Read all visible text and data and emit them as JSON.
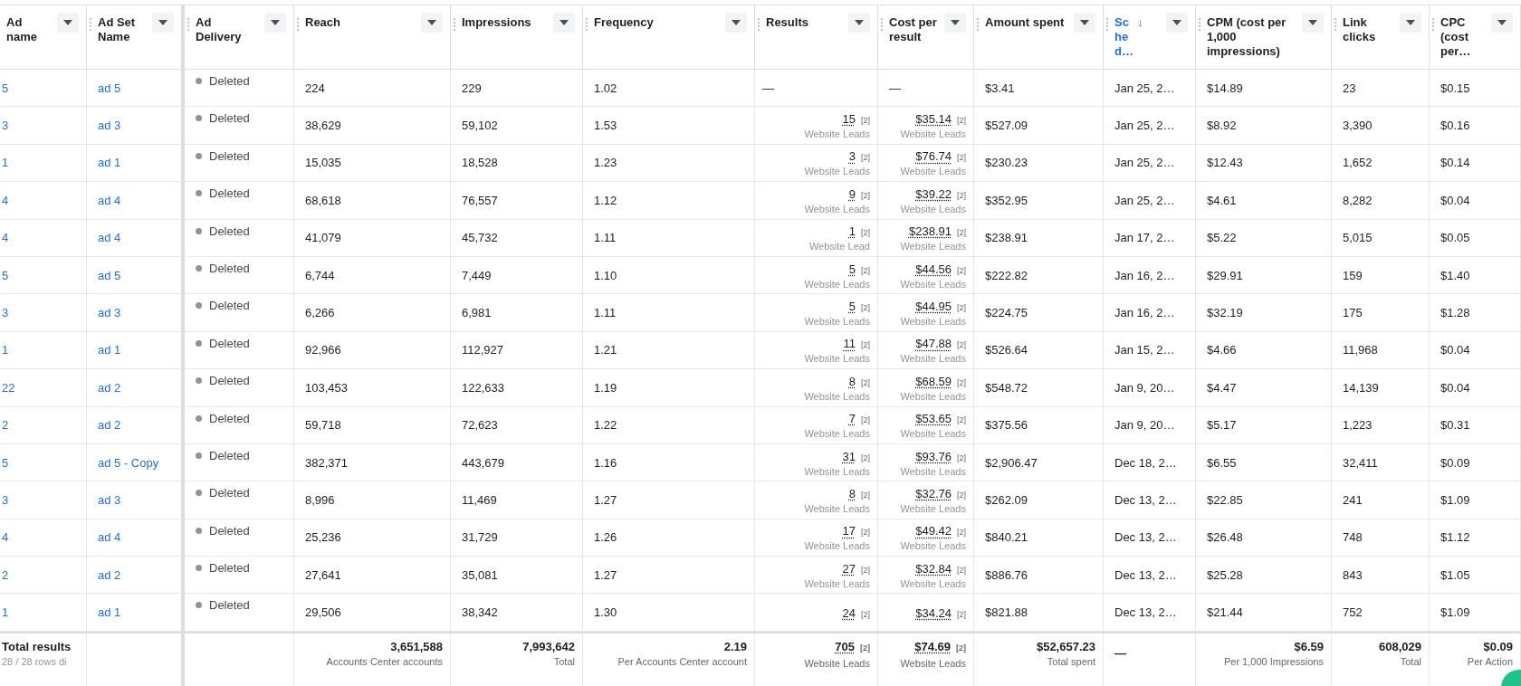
{
  "columns": [
    {
      "label": "Ad name",
      "sorted": false
    },
    {
      "label": "Ad Set Name",
      "sorted": false
    },
    {
      "label": "Ad Delivery",
      "sorted": false
    },
    {
      "label": "Reach",
      "sorted": false
    },
    {
      "label": "Impressions",
      "sorted": false
    },
    {
      "label": "Frequency",
      "sorted": false
    },
    {
      "label": "Results",
      "sorted": false
    },
    {
      "label": "Cost per result",
      "sorted": false
    },
    {
      "label": "Amount spent",
      "sorted": false
    },
    {
      "label": "Sched…",
      "sorted": true,
      "sort_arrow": "↓"
    },
    {
      "label": "CPM (cost per 1,000 impressions)",
      "sorted": false
    },
    {
      "label": "Link clicks",
      "sorted": false
    },
    {
      "label": "CPC (cost per…",
      "sorted": false
    }
  ],
  "rows": [
    {
      "ad_name": "5",
      "ad_set": "ad 5",
      "delivery": "Deleted",
      "reach": "224",
      "impressions": "229",
      "frequency": "1.02",
      "results": {
        "value": "—"
      },
      "cost_per_result": {
        "value": "—"
      },
      "amount_spent": "$3.41",
      "schedule": "Jan 25, 2…",
      "cpm": "$14.89",
      "link_clicks": "23",
      "cpc": "$0.15"
    },
    {
      "ad_name": "3",
      "ad_set": "ad 3",
      "delivery": "Deleted",
      "reach": "38,629",
      "impressions": "59,102",
      "frequency": "1.53",
      "results": {
        "value": "15",
        "note": "[2]",
        "sub": "Website Leads"
      },
      "cost_per_result": {
        "value": "$35.14",
        "note": "[2]",
        "sub": "Website Leads"
      },
      "amount_spent": "$527.09",
      "schedule": "Jan 25, 2…",
      "cpm": "$8.92",
      "link_clicks": "3,390",
      "cpc": "$0.16"
    },
    {
      "ad_name": "1",
      "ad_set": "ad 1",
      "delivery": "Deleted",
      "reach": "15,035",
      "impressions": "18,528",
      "frequency": "1.23",
      "results": {
        "value": "3",
        "note": "[2]",
        "sub": "Website Leads"
      },
      "cost_per_result": {
        "value": "$76.74",
        "note": "[2]",
        "sub": "Website Leads"
      },
      "amount_spent": "$230.23",
      "schedule": "Jan 25, 2…",
      "cpm": "$12.43",
      "link_clicks": "1,652",
      "cpc": "$0.14"
    },
    {
      "ad_name": "4",
      "ad_set": "ad 4",
      "delivery": "Deleted",
      "reach": "68,618",
      "impressions": "76,557",
      "frequency": "1.12",
      "results": {
        "value": "9",
        "note": "[2]",
        "sub": "Website Leads"
      },
      "cost_per_result": {
        "value": "$39.22",
        "note": "[2]",
        "sub": "Website Leads"
      },
      "amount_spent": "$352.95",
      "schedule": "Jan 25, 2…",
      "cpm": "$4.61",
      "link_clicks": "8,282",
      "cpc": "$0.04"
    },
    {
      "ad_name": "4",
      "ad_set": "ad 4",
      "delivery": "Deleted",
      "reach": "41,079",
      "impressions": "45,732",
      "frequency": "1.11",
      "results": {
        "value": "1",
        "note": "[2]",
        "sub": "Website Lead"
      },
      "cost_per_result": {
        "value": "$238.91",
        "note": "[2]",
        "sub": "Website Leads"
      },
      "amount_spent": "$238.91",
      "schedule": "Jan 17, 2…",
      "cpm": "$5.22",
      "link_clicks": "5,015",
      "cpc": "$0.05"
    },
    {
      "ad_name": "5",
      "ad_set": "ad 5",
      "delivery": "Deleted",
      "reach": "6,744",
      "impressions": "7,449",
      "frequency": "1.10",
      "results": {
        "value": "5",
        "note": "[2]",
        "sub": "Website Leads"
      },
      "cost_per_result": {
        "value": "$44.56",
        "note": "[2]",
        "sub": "Website Leads"
      },
      "amount_spent": "$222.82",
      "schedule": "Jan 16, 2…",
      "cpm": "$29.91",
      "link_clicks": "159",
      "cpc": "$1.40"
    },
    {
      "ad_name": "3",
      "ad_set": "ad 3",
      "delivery": "Deleted",
      "reach": "6,266",
      "impressions": "6,981",
      "frequency": "1.11",
      "results": {
        "value": "5",
        "note": "[2]",
        "sub": "Website Leads"
      },
      "cost_per_result": {
        "value": "$44.95",
        "note": "[2]",
        "sub": "Website Leads"
      },
      "amount_spent": "$224.75",
      "schedule": "Jan 16, 2…",
      "cpm": "$32.19",
      "link_clicks": "175",
      "cpc": "$1.28"
    },
    {
      "ad_name": "1",
      "ad_set": "ad 1",
      "delivery": "Deleted",
      "reach": "92,966",
      "impressions": "112,927",
      "frequency": "1.21",
      "results": {
        "value": "11",
        "note": "[2]",
        "sub": "Website Leads"
      },
      "cost_per_result": {
        "value": "$47.88",
        "note": "[2]",
        "sub": "Website Leads"
      },
      "amount_spent": "$526.64",
      "schedule": "Jan 15, 2…",
      "cpm": "$4.66",
      "link_clicks": "11,968",
      "cpc": "$0.04"
    },
    {
      "ad_name": "22",
      "ad_set": "ad 2",
      "delivery": "Deleted",
      "reach": "103,453",
      "impressions": "122,633",
      "frequency": "1.19",
      "results": {
        "value": "8",
        "note": "[2]",
        "sub": "Website Leads"
      },
      "cost_per_result": {
        "value": "$68.59",
        "note": "[2]",
        "sub": "Website Leads"
      },
      "amount_spent": "$548.72",
      "schedule": "Jan 9, 20…",
      "cpm": "$4.47",
      "link_clicks": "14,139",
      "cpc": "$0.04"
    },
    {
      "ad_name": "2",
      "ad_set": "ad 2",
      "delivery": "Deleted",
      "reach": "59,718",
      "impressions": "72,623",
      "frequency": "1.22",
      "results": {
        "value": "7",
        "note": "[2]",
        "sub": "Website Leads"
      },
      "cost_per_result": {
        "value": "$53.65",
        "note": "[2]",
        "sub": "Website Leads"
      },
      "amount_spent": "$375.56",
      "schedule": "Jan 9, 20…",
      "cpm": "$5.17",
      "link_clicks": "1,223",
      "cpc": "$0.31"
    },
    {
      "ad_name": "5",
      "ad_set": "ad 5 - Copy",
      "delivery": "Deleted",
      "reach": "382,371",
      "impressions": "443,679",
      "frequency": "1.16",
      "results": {
        "value": "31",
        "note": "[2]",
        "sub": "Website Leads"
      },
      "cost_per_result": {
        "value": "$93.76",
        "note": "[2]",
        "sub": "Website Leads"
      },
      "amount_spent": "$2,906.47",
      "schedule": "Dec 18, 2…",
      "cpm": "$6.55",
      "link_clicks": "32,411",
      "cpc": "$0.09"
    },
    {
      "ad_name": "3",
      "ad_set": "ad 3",
      "delivery": "Deleted",
      "reach": "8,996",
      "impressions": "11,469",
      "frequency": "1.27",
      "results": {
        "value": "8",
        "note": "[2]",
        "sub": "Website Leads"
      },
      "cost_per_result": {
        "value": "$32.76",
        "note": "[2]",
        "sub": "Website Leads"
      },
      "amount_spent": "$262.09",
      "schedule": "Dec 13, 2…",
      "cpm": "$22.85",
      "link_clicks": "241",
      "cpc": "$1.09"
    },
    {
      "ad_name": "4",
      "ad_set": "ad 4",
      "delivery": "Deleted",
      "reach": "25,236",
      "impressions": "31,729",
      "frequency": "1.26",
      "results": {
        "value": "17",
        "note": "[2]",
        "sub": "Website Leads"
      },
      "cost_per_result": {
        "value": "$49.42",
        "note": "[2]",
        "sub": "Website Leads"
      },
      "amount_spent": "$840.21",
      "schedule": "Dec 13, 2…",
      "cpm": "$26.48",
      "link_clicks": "748",
      "cpc": "$1.12"
    },
    {
      "ad_name": "2",
      "ad_set": "ad 2",
      "delivery": "Deleted",
      "reach": "27,641",
      "impressions": "35,081",
      "frequency": "1.27",
      "results": {
        "value": "27",
        "note": "[2]",
        "sub": "Website Leads"
      },
      "cost_per_result": {
        "value": "$32.84",
        "note": "[2]",
        "sub": "Website Leads"
      },
      "amount_spent": "$886.76",
      "schedule": "Dec 13, 2…",
      "cpm": "$25.28",
      "link_clicks": "843",
      "cpc": "$1.05"
    },
    {
      "ad_name": "1",
      "ad_set": "ad 1",
      "delivery": "Deleted",
      "reach": "29,506",
      "impressions": "38,342",
      "frequency": "1.30",
      "results": {
        "value": "24",
        "note": "[2]"
      },
      "cost_per_result": {
        "value": "$34.24",
        "note": "[2]"
      },
      "amount_spent": "$821.88",
      "schedule": "Dec 13, 2…",
      "cpm": "$21.44",
      "link_clicks": "752",
      "cpc": "$1.09"
    }
  ],
  "totals": {
    "label": "Total results",
    "sub": "28 / 28 rows di",
    "cells": {
      "reach": {
        "value": "3,651,588",
        "sub": "Accounts Center accounts"
      },
      "impressions": {
        "value": "7,993,642",
        "sub": "Total"
      },
      "frequency": {
        "value": "2.19",
        "sub": "Per Accounts Center account"
      },
      "results": {
        "value": "705",
        "note": "[2]",
        "sub": "Website Leads",
        "kind": "result"
      },
      "cost_per_result": {
        "value": "$74.69",
        "note": "[2]",
        "sub": "Website Leads",
        "kind": "result"
      },
      "amount_spent": {
        "value": "$52,657.23",
        "sub": "Total spent"
      },
      "schedule": {
        "value": "—",
        "kind": "dash"
      },
      "cpm": {
        "value": "$6.59",
        "sub": "Per 1,000 Impressions"
      },
      "link_clicks": {
        "value": "608,029",
        "sub": "Total"
      },
      "cpc": {
        "value": "$0.09",
        "sub": "Per Action"
      }
    }
  }
}
